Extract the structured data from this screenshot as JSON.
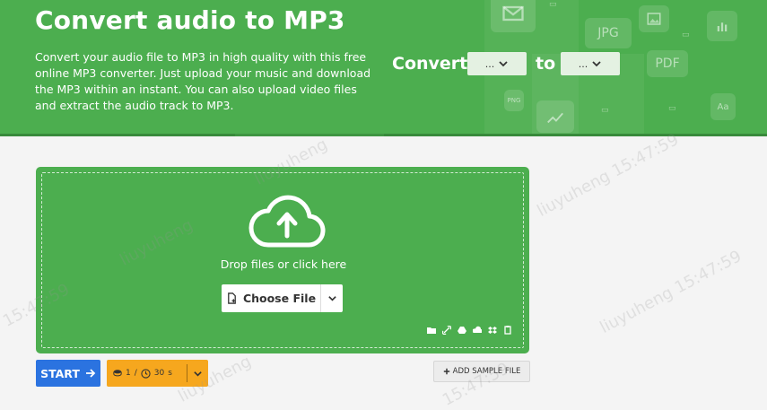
{
  "hero": {
    "title": "Convert audio to MP3",
    "description": "Convert your audio file to MP3 in high quality with this free online MP3 converter. Just upload your music and download the MP3 within an instant. You can also upload video files and extract the audio track to MP3.",
    "convert_label": "Convert",
    "to_label": "to",
    "from_select_value": "...",
    "to_select_value": "...",
    "deco_labels": [
      "JPG",
      "PDF",
      "PNG"
    ]
  },
  "dropzone": {
    "prompt": "Drop files or click here",
    "choose_label": "Choose File",
    "sources": [
      "folder-icon",
      "link-icon",
      "google-drive-icon",
      "onedrive-icon",
      "dropbox-icon",
      "clipboard-icon"
    ]
  },
  "actions": {
    "start_label": "START",
    "credits_count": "1",
    "credits_sep": "/",
    "time_value": "30",
    "time_unit": "s",
    "sample_label": "ADD SAMPLE FILE"
  },
  "watermark": {
    "user": "liuyuheng",
    "time": "15:47:59"
  },
  "colors": {
    "brand_green": "#4cae4f",
    "start_blue": "#2b73e0",
    "credits_orange": "#f6a71e"
  }
}
